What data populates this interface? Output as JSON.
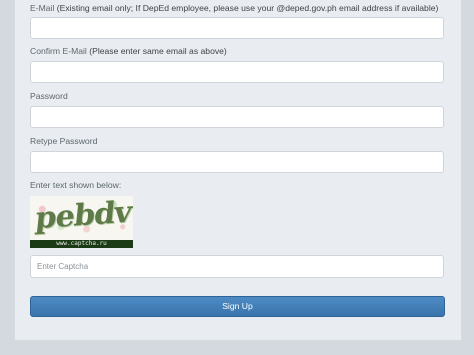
{
  "form": {
    "email": {
      "label_main": "E-Mail",
      "label_note": "(Existing email only; If DepEd employee, please use your @deped.gov.ph email address if available)",
      "value": ""
    },
    "confirm_email": {
      "label_main": "Confirm E-Mail",
      "label_note": "(Please enter same email as above)",
      "value": ""
    },
    "password": {
      "label": "Password",
      "value": ""
    },
    "retype_password": {
      "label": "Retype Password",
      "value": ""
    },
    "captcha": {
      "label": "Enter text shown below:",
      "image_text": "pebdv",
      "image_footer": "www.captcha.ru",
      "placeholder": "Enter Captcha"
    },
    "submit_label": "Sign Up"
  }
}
